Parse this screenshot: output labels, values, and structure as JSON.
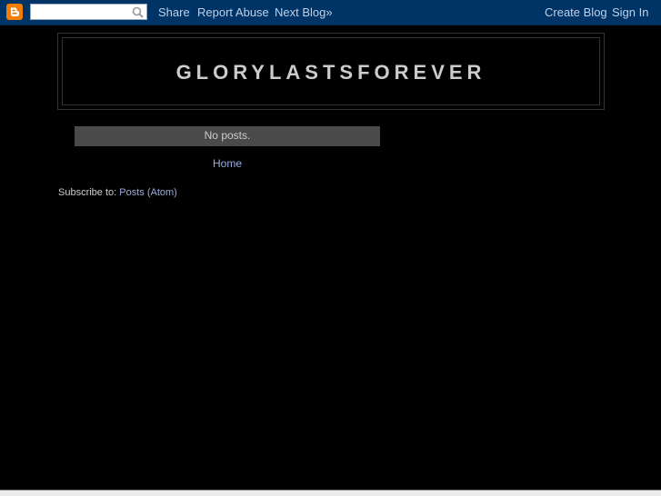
{
  "navbar": {
    "logo": "blogger-logo-icon",
    "search": {
      "value": "",
      "placeholder": "",
      "icon": "search-icon"
    },
    "links_left": [
      "Share",
      "Report Abuse",
      "Next Blog»"
    ],
    "links_right": [
      "Create Blog",
      "Sign In"
    ],
    "colors": {
      "background": "#003366",
      "link": "#bdd1ea",
      "logo": "#f57d00"
    }
  },
  "header": {
    "title": "GLORYLASTSFOREVER"
  },
  "main": {
    "status": "No posts.",
    "home_link": "Home"
  },
  "footer": {
    "subscribe_label": "Subscribe to:",
    "subscribe_link": "Posts (Atom)"
  },
  "colors": {
    "page_background": "#000000",
    "text": "#cccccc",
    "link": "#99aadd",
    "status_bar": "#4a4a4a"
  }
}
